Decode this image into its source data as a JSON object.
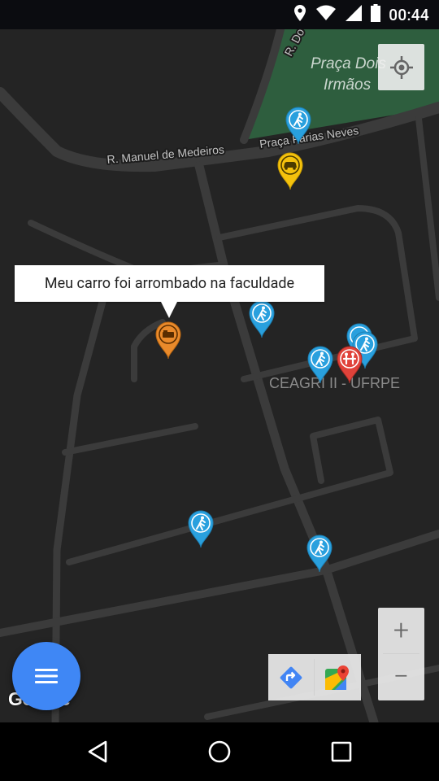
{
  "status_bar": {
    "time": "00:44"
  },
  "map": {
    "streets": {
      "manuel_de_medeiros": "R. Manuel de Medeiros",
      "praca_farias_neves": "Praça Farias Neves",
      "r_do": "R. Do"
    },
    "places": {
      "praca_dois_irmaos_line1": "Praça Dois",
      "praca_dois_irmaos_line2": "Irmãos",
      "ceagri": "CEAGRI II - UFRPE"
    },
    "google_logo": "Google"
  },
  "tooltip": {
    "text": "Meu carro foi arrombado na faculdade"
  },
  "markers": [
    {
      "kind": "pedestrian",
      "color": "#29a0de",
      "icon": "pedestrian-icon"
    },
    {
      "kind": "car",
      "color": "#f4c20d",
      "icon": "car-icon"
    },
    {
      "kind": "pedestrian",
      "color": "#29a0de",
      "icon": "pedestrian-icon"
    },
    {
      "kind": "bed-break-in",
      "color": "#e98a2b",
      "icon": "bed-icon"
    },
    {
      "kind": "pedestrian",
      "color": "#29a0de",
      "icon": "pedestrian-icon"
    },
    {
      "kind": "pedestrian",
      "color": "#29a0de",
      "icon": "pedestrian-icon"
    },
    {
      "kind": "pedestrian",
      "color": "#29a0de",
      "icon": "pedestrian-icon"
    },
    {
      "kind": "group",
      "color": "#e0423a",
      "icon": "people-icon"
    },
    {
      "kind": "pedestrian",
      "color": "#29a0de",
      "icon": "pedestrian-icon"
    },
    {
      "kind": "pedestrian",
      "color": "#29a0de",
      "icon": "pedestrian-icon"
    }
  ],
  "zoom": {
    "in": "+",
    "out": "−"
  },
  "colors": {
    "map_background": "#242424",
    "park": "#2e5e3e",
    "fab": "#3f87f5"
  }
}
